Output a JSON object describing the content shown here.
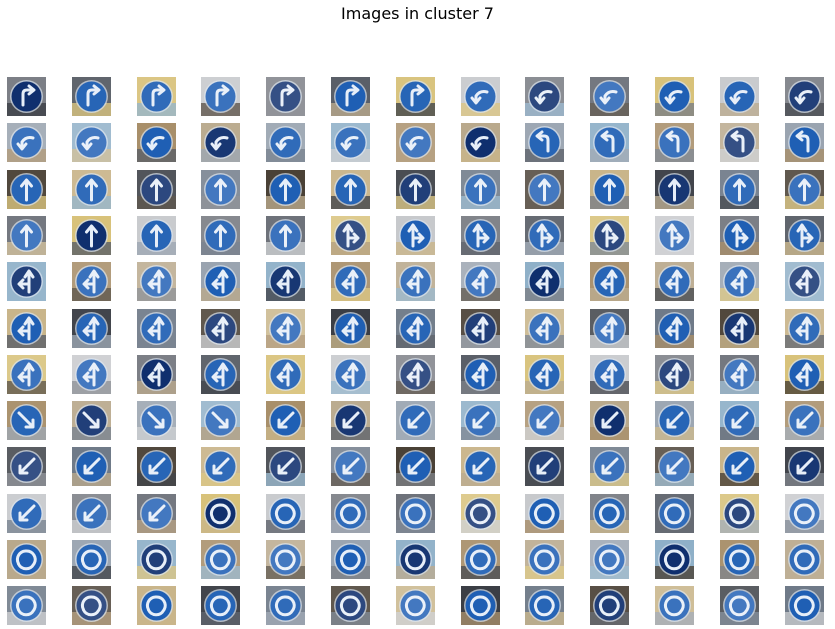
{
  "figure": {
    "title": "Images in cluster 7"
  },
  "grid": {
    "rows": 12,
    "cols": 13,
    "row_kinds": [
      [
        "turn-right",
        "turn-right",
        "turn-right",
        "turn-right",
        "turn-right",
        "turn-right",
        "turn-right",
        "turn-left-down",
        "turn-left-down",
        "turn-left-down",
        "turn-left-down",
        "turn-left-down",
        "turn-left-down"
      ],
      [
        "turn-left-down",
        "turn-left-down",
        "turn-left-down",
        "turn-left-down",
        "turn-left-down",
        "turn-left-down",
        "turn-left-down",
        "turn-left-down",
        "turn-left",
        "turn-left",
        "turn-left",
        "turn-left",
        "turn-left"
      ],
      [
        "straight",
        "straight",
        "straight",
        "straight",
        "straight",
        "straight",
        "straight",
        "straight",
        "straight",
        "straight",
        "straight",
        "straight",
        "straight"
      ],
      [
        "straight",
        "straight",
        "straight",
        "straight",
        "straight",
        "straight-right",
        "straight-right",
        "straight-right",
        "straight-right",
        "straight-right",
        "straight-right",
        "straight-right",
        "straight-right"
      ],
      [
        "straight-left",
        "straight-left",
        "straight-left",
        "straight-left",
        "straight-left",
        "straight-left",
        "straight-left",
        "straight-left",
        "straight-left",
        "straight-left",
        "straight-left",
        "straight-left",
        "straight-left"
      ],
      [
        "straight-left",
        "straight-left",
        "straight-left",
        "straight-left",
        "straight-left",
        "straight-left",
        "straight-left",
        "straight-left",
        "straight-left",
        "straight-left",
        "straight-left",
        "straight-left",
        "straight-left"
      ],
      [
        "straight-left",
        "straight-left",
        "straight-left",
        "straight-left",
        "straight-left",
        "straight-left",
        "straight-left",
        "straight-left",
        "straight-left",
        "straight-left",
        "straight-left",
        "straight-left",
        "straight-left"
      ],
      [
        "keep-right",
        "keep-right",
        "keep-right",
        "keep-right",
        "keep-left",
        "keep-left",
        "keep-left",
        "keep-left",
        "keep-left",
        "keep-left",
        "keep-left",
        "keep-left",
        "keep-left"
      ],
      [
        "keep-left",
        "keep-left",
        "keep-left",
        "keep-left",
        "keep-left",
        "keep-left",
        "keep-left",
        "keep-left",
        "keep-left",
        "keep-left",
        "keep-left",
        "keep-left",
        "keep-left"
      ],
      [
        "keep-left",
        "keep-left",
        "keep-left",
        "roundabout",
        "roundabout",
        "roundabout",
        "roundabout",
        "roundabout",
        "roundabout",
        "roundabout",
        "roundabout",
        "roundabout",
        "roundabout"
      ],
      [
        "roundabout",
        "roundabout",
        "roundabout",
        "roundabout",
        "roundabout",
        "roundabout",
        "roundabout",
        "roundabout",
        "roundabout",
        "roundabout",
        "roundabout",
        "roundabout",
        "roundabout"
      ],
      [
        "roundabout",
        "roundabout",
        "roundabout",
        "roundabout",
        "roundabout",
        "roundabout",
        "roundabout",
        "roundabout",
        "roundabout",
        "roundabout",
        "roundabout",
        "roundabout",
        "roundabout"
      ]
    ]
  },
  "colors": {
    "sign_blue": "#1f5fb4",
    "sign_dark_blue": "#0f2f6e",
    "arrow_white": "#e6eef8",
    "backgrounds": [
      "#7c7f86",
      "#c9b58a",
      "#b9a98c",
      "#5a5f68",
      "#3b3e45",
      "#9aa4b0",
      "#d8c27a",
      "#6f7a88",
      "#8fb0c8",
      "#c7c9cc",
      "#4a4136",
      "#a88f6a"
    ]
  }
}
